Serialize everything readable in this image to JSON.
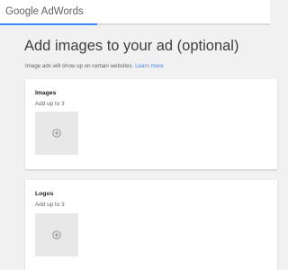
{
  "app": {
    "brand_google": "Google",
    "brand_product": "AdWords",
    "progress": 0.36
  },
  "page": {
    "title": "Add images to your ad (optional)",
    "subtitle": "Image ads will show up on certain websites.",
    "learn_more": "Learn more"
  },
  "sections": [
    {
      "title": "Images",
      "hint": "Add up to 3",
      "icon": "add-circle-icon"
    },
    {
      "title": "Logos",
      "hint": "Add up to 3",
      "icon": "add-circle-icon"
    }
  ],
  "colors": {
    "accent": "#4285f4",
    "background": "#f1f1f1"
  }
}
